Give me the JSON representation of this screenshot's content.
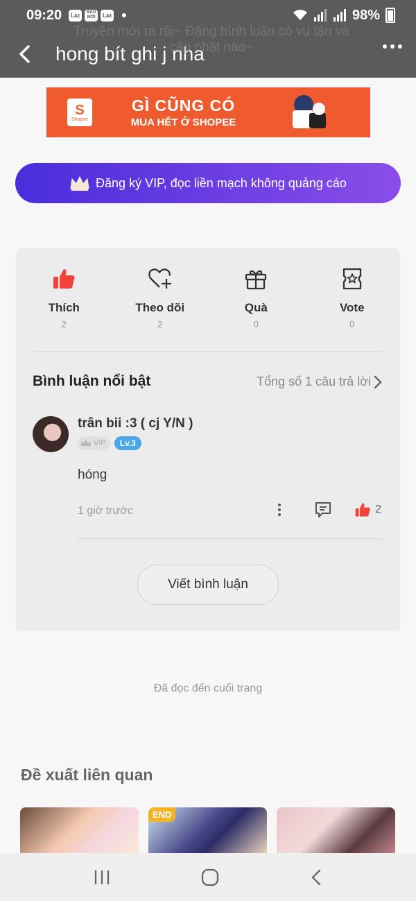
{
  "status_bar": {
    "time": "09:20",
    "notif_badges": [
      "Laz",
      "BÁO MỚI",
      "Laz"
    ],
    "battery": "98%"
  },
  "header": {
    "title": "hong bít ghi j nha",
    "ghost_text": "Truyện mới ra rồi~ Đăng bình luận có vụ tận và cập nhật nào~"
  },
  "ad": {
    "brand": "Shopee",
    "line1": "GÌ CŨNG CÓ",
    "line2": "MUA HẾT Ở SHOPEE",
    "color": "#f05a2f"
  },
  "vip_banner": {
    "text": "Đăng ký VIP, đọc liền mạch không quảng cáo",
    "icon": "crown-icon"
  },
  "actions": [
    {
      "label": "Thích",
      "count": "2",
      "icon": "thumbs-up-icon"
    },
    {
      "label": "Theo dõi",
      "count": "2",
      "icon": "heart-plus-icon"
    },
    {
      "label": "Quà",
      "count": "0",
      "icon": "gift-icon"
    },
    {
      "label": "Vote",
      "count": "0",
      "icon": "vote-ticket-icon"
    }
  ],
  "featured": {
    "title": "Bình luận nổi bật",
    "total": "Tổng số 1 câu trả lời"
  },
  "comment": {
    "username": "trân bii :3 ( cj Y/N )",
    "vip_label": "VIP",
    "level": "Lv.3",
    "text": "hóng",
    "time": "1 giờ trước",
    "likes": "2"
  },
  "write_comment": "Viết bình luận",
  "end_text": "Đã đọc đến cuối trang",
  "related": {
    "title": "Đề xuất liên quan",
    "end_tag": "END"
  },
  "colors": {
    "accent_red": "#f2433b",
    "vip_gradient_start": "#4a2ddb",
    "vip_gradient_end": "#8a4de8",
    "level_blue": "#4aa8e8"
  }
}
